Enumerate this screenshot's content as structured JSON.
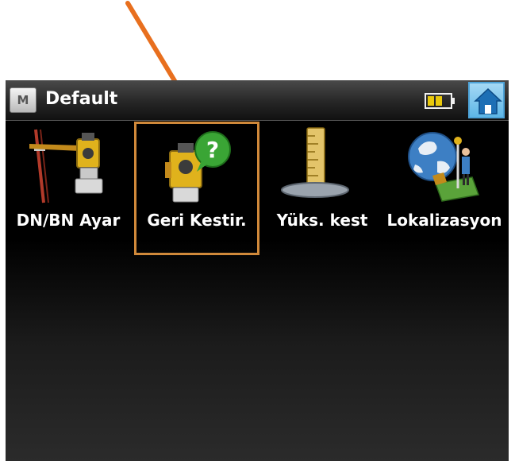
{
  "titlebar": {
    "title": "Default",
    "menu_letter": "M",
    "icons": [
      "menu-icon",
      "battery-icon",
      "home-icon"
    ]
  },
  "apps": [
    {
      "label": "DN/BN Ayar",
      "icon": "level-staff-instrument-icon"
    },
    {
      "label": "Geri Kestir.",
      "icon": "instrument-help-icon",
      "selected": true
    },
    {
      "label": "Yüks. kest",
      "icon": "height-ruler-icon"
    },
    {
      "label": "Lokalizasyon",
      "icon": "globe-surveyor-icon"
    }
  ],
  "colors": {
    "arrow": "#e86f1e",
    "selection_border": "#d0893a",
    "instrument_yellow": "#e0b21c",
    "home_blue": "#4da3d8"
  }
}
